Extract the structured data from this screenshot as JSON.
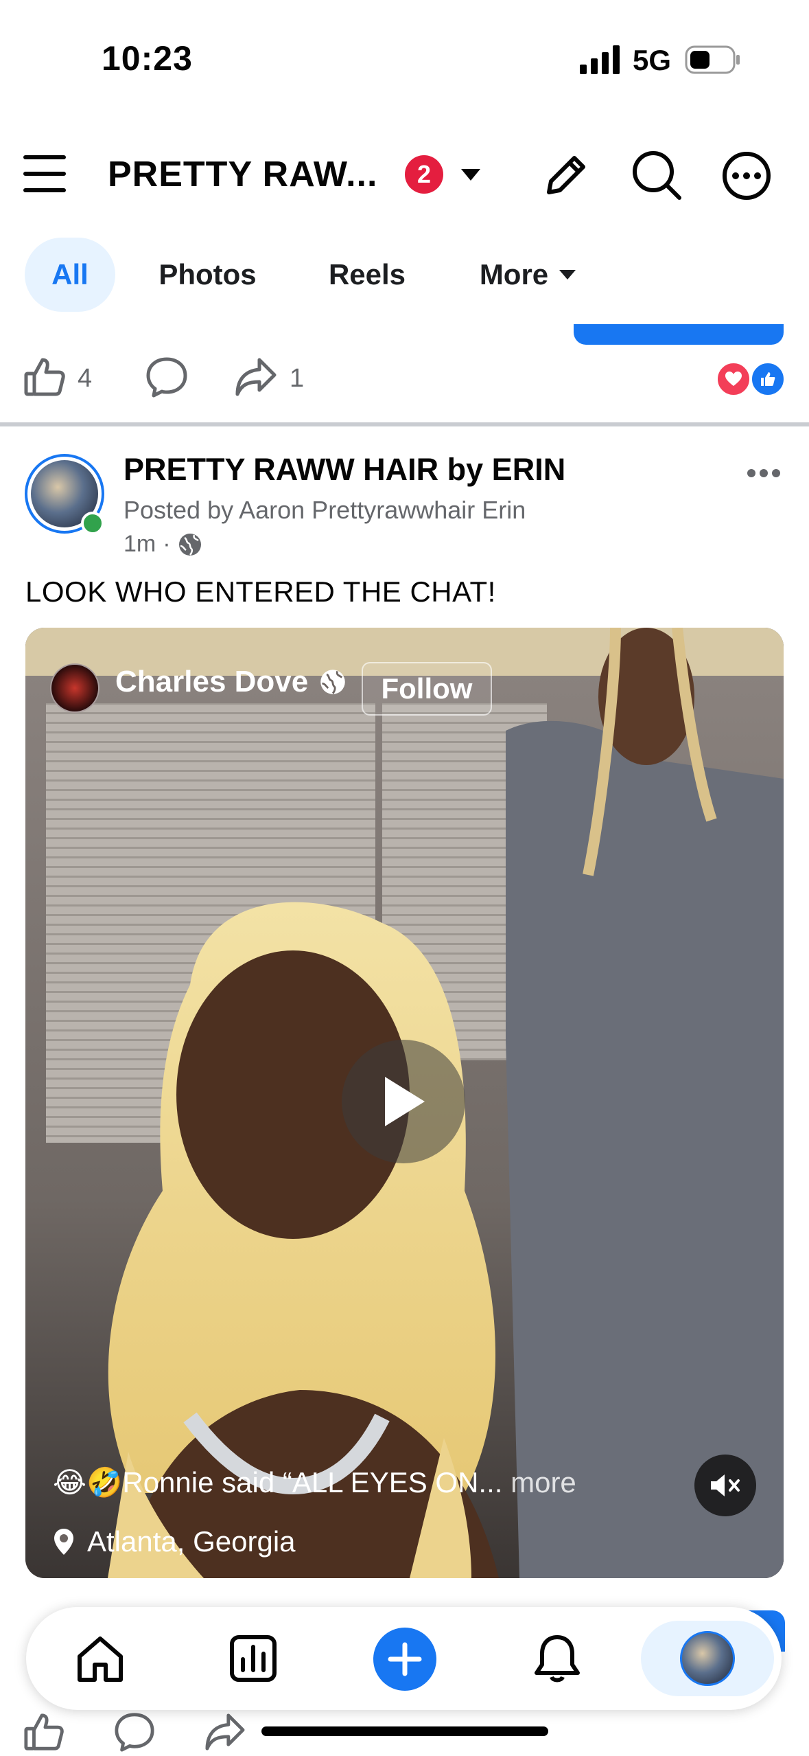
{
  "status_bar": {
    "time": "10:23",
    "network": "5G"
  },
  "header": {
    "title": "PRETTY RAW...",
    "notification_count": "2"
  },
  "tabs": [
    {
      "label": "All"
    },
    {
      "label": "Photos"
    },
    {
      "label": "Reels"
    },
    {
      "label": "More"
    }
  ],
  "previous_post": {
    "likes": "4",
    "shares": "1"
  },
  "post": {
    "author": "PRETTY RAWW HAIR by ERIN",
    "posted_by": "Posted by Aaron Prettyrawwhair Erin",
    "time": "1m",
    "caption": "LOOK WHO ENTERED THE CHAT!",
    "video": {
      "creator": "Charles Dove",
      "follow_label": "Follow",
      "overlay_caption": "😂🤣Ronnie said “ALL EYES ON...",
      "more_label": "more",
      "location": "Atlanta, Georgia"
    }
  },
  "colors": {
    "accent": "#1877f2",
    "badge": "#e41e3f",
    "love": "#f33e58"
  }
}
